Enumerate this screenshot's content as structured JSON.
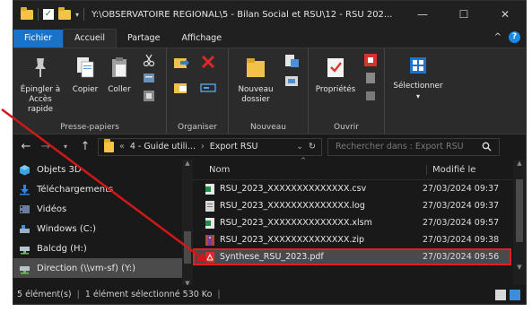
{
  "titlebar": {
    "title": "Y:\\OBSERVATOIRE REGIONAL\\5 - Bilan Social et RSU\\12 - RSU 202...",
    "minimize": "—",
    "maximize": "☐",
    "close": "✕"
  },
  "ribbon_tabs": [
    "Fichier",
    "Accueil",
    "Partage",
    "Affichage"
  ],
  "ribbon": {
    "pin_label_1": "Épingler à",
    "pin_label_2": "Accès rapide",
    "copy_label": "Copier",
    "paste_label": "Coller",
    "group_clipboard": "Presse-papiers",
    "group_organize": "Organiser",
    "new_folder_1": "Nouveau",
    "new_folder_2": "dossier",
    "group_new": "Nouveau",
    "properties_label": "Propriétés",
    "group_open": "Ouvrir",
    "select_label": "Sélectionner"
  },
  "address": {
    "prefix": "«",
    "crumb1": "4 - Guide utili...",
    "sep": "›",
    "crumb2": "Export RSU",
    "search_placeholder": "Rechercher dans : Export RSU"
  },
  "nav_items": [
    {
      "label": "Objets 3D",
      "icon": "cube-icon"
    },
    {
      "label": "Téléchargements",
      "icon": "download-icon"
    },
    {
      "label": "Vidéos",
      "icon": "video-icon"
    },
    {
      "label": "Windows (C:)",
      "icon": "drive-icon"
    },
    {
      "label": "Balcdg (H:)",
      "icon": "network-drive-icon"
    },
    {
      "label": "Direction (\\\\vm-sf) (Y:)",
      "icon": "network-drive-icon"
    }
  ],
  "columns": {
    "name": "Nom",
    "modified": "Modifié le"
  },
  "files": [
    {
      "name": "RSU_2023_XXXXXXXXXXXXXX.csv",
      "modified": "27/03/2024 09:37",
      "icon": "excel-csv-icon",
      "color": "#1f8f4e"
    },
    {
      "name": "RSU_2023_XXXXXXXXXXXXXX.log",
      "modified": "27/03/2024 09:37",
      "icon": "text-file-icon",
      "color": "#d8d8d8"
    },
    {
      "name": "RSU_2023_XXXXXXXXXXXXXX.xlsm",
      "modified": "27/03/2024 09:57",
      "icon": "excel-icon",
      "color": "#1f8f4e"
    },
    {
      "name": "RSU_2023_XXXXXXXXXXXXXX.zip",
      "modified": "27/03/2024 09:38",
      "icon": "zip-icon",
      "color": "#b0483c"
    },
    {
      "name": "Synthese_RSU_2023.pdf",
      "modified": "27/03/2024 09:56",
      "icon": "pdf-icon",
      "color": "#e3262b"
    }
  ],
  "status": {
    "count": "5 élément(s)",
    "sep": "|",
    "selection": "1 élément sélectionné  530 Ko",
    "sep2": "|"
  },
  "colors": {
    "accent": "#1b73c8",
    "highlight": "#e02020",
    "arrow": "#d01818"
  }
}
